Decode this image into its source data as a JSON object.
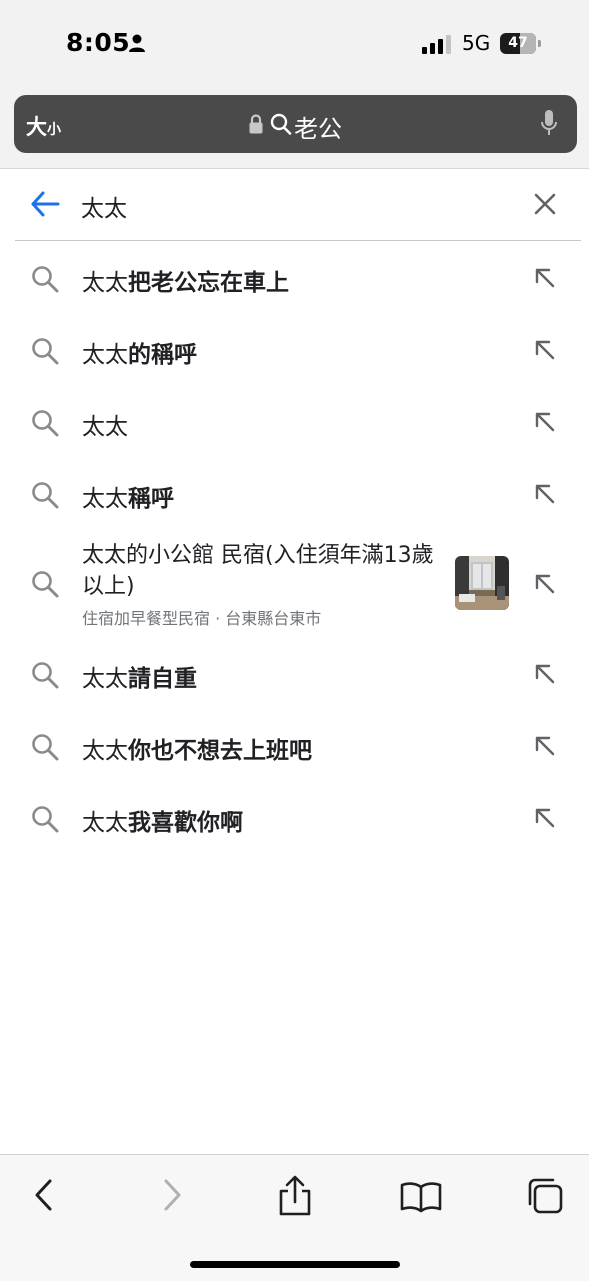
{
  "status_bar": {
    "time": "8:05",
    "network": "5G",
    "battery": "47",
    "icons": [
      "person-icon",
      "cellular-signal-icon",
      "battery-icon"
    ]
  },
  "url_bar": {
    "text_size_large": "大",
    "text_size_small": "小",
    "query": "老公",
    "icons": [
      "lock-icon",
      "search-icon",
      "microphone-icon"
    ]
  },
  "search": {
    "query": "太太",
    "icons": [
      "back-arrow-icon",
      "clear-icon"
    ]
  },
  "suggestions": [
    {
      "prefix": "太太",
      "rest": "把老公忘在車上"
    },
    {
      "prefix": "太太",
      "rest": "的稱呼"
    },
    {
      "prefix": "太太",
      "rest": ""
    },
    {
      "prefix": "太太",
      "rest": "稱呼"
    },
    {
      "prefix": "太太",
      "rest": "請自重"
    },
    {
      "prefix": "太太",
      "rest": "你也不想去上班吧"
    },
    {
      "prefix": "太太",
      "rest": "我喜歡你啊"
    }
  ],
  "rich_suggestion": {
    "title": "太太的小公館 民宿(入住須年滿13歲以上)",
    "subtitle": "住宿加早餐型民宿 · 台東縣台東市"
  },
  "toolbar": {
    "icons": [
      "back-icon",
      "forward-icon",
      "share-icon",
      "bookmarks-icon",
      "tabs-icon"
    ]
  },
  "colors": {
    "accent": "#1a73e8",
    "url_bar_bg": "#4a4a4a",
    "chrome_bg": "#f2f2f2",
    "secondary_text": "#70757a"
  }
}
